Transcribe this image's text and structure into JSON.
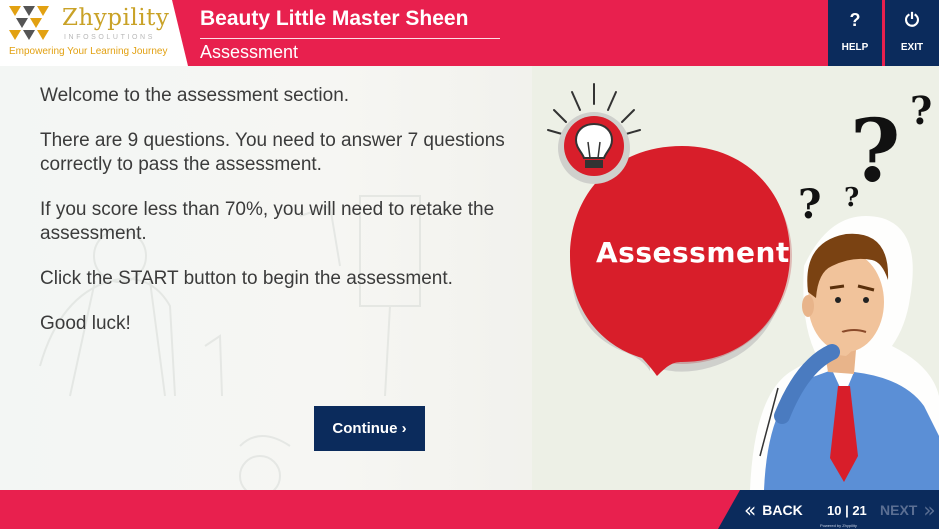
{
  "brand": {
    "name": "Zhypility",
    "sub": "INFOSOLUTIONS",
    "tagline": "Empowering Your Learning Journey"
  },
  "header": {
    "course_title": "Beauty Little Master Sheen",
    "section_title": "Assessment",
    "help": {
      "icon_text": "?",
      "label": "HELP"
    },
    "exit": {
      "icon_text": "⏻",
      "label": "EXIT"
    }
  },
  "content": {
    "paragraphs": [
      "Welcome to the assessment section.",
      "There are 9 questions. You need to answer 7 questions correctly to pass the assessment.",
      "If you score less than 70%, you will need to retake the assessment.",
      "Click the START button to begin the assessment.",
      "Good luck!"
    ],
    "continue_label": "Continue ›"
  },
  "illustration": {
    "bubble_text": "Assessment"
  },
  "footer": {
    "back_icon": "«",
    "back_label": "BACK",
    "page_current": "10",
    "page_total": "21",
    "page_display": "10 | 21",
    "next_label": "NEXT",
    "next_icon": "»",
    "powered_by": "Powered by Zhypility"
  },
  "colors": {
    "brand_red": "#e8204e",
    "navy": "#0b2b5c",
    "gold": "#c9a227",
    "bubble_red": "#d81e2a"
  }
}
